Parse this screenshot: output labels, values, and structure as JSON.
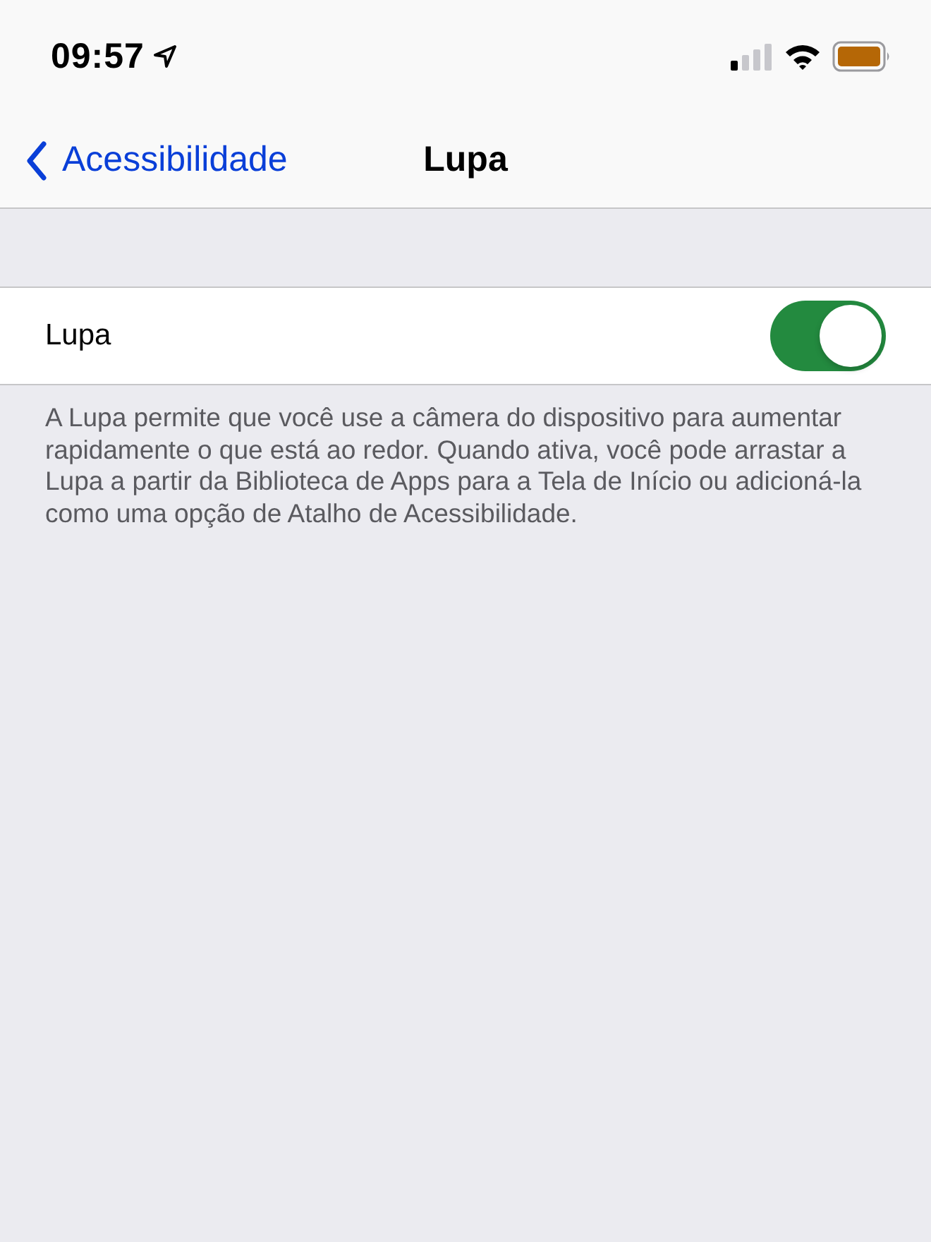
{
  "status_bar": {
    "time": "09:57",
    "location_on": true
  },
  "nav_bar": {
    "back_label": "Acessibilidade",
    "title": "Lupa"
  },
  "settings": [
    {
      "label": "Lupa",
      "on": true
    }
  ],
  "footer": "A Lupa permite que você use a câmera do dispositivo para aumentar rapidamente o que está ao redor. Quando ativa, você pode arrastar a Lupa a partir da Biblioteca de Apps para a Tela de Início ou adicioná-la como uma opção de Atalho de Acessibilidade."
}
